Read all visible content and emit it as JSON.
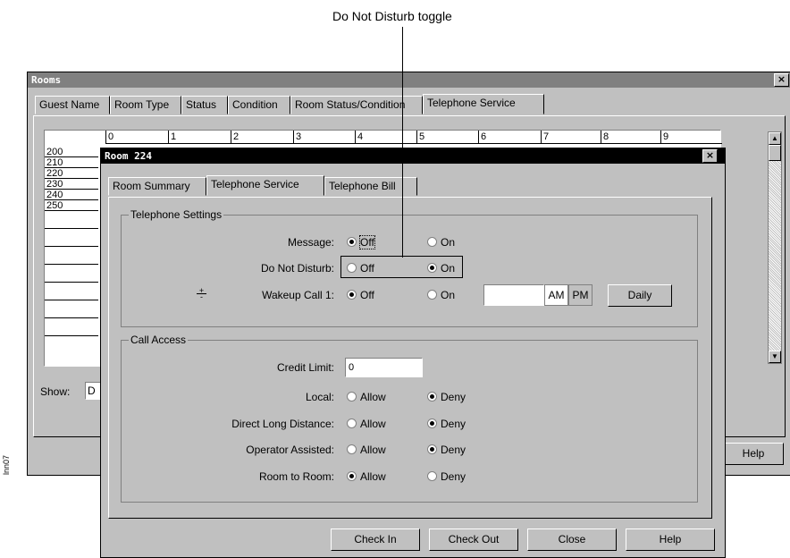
{
  "callout": {
    "label": "Do Not Disturb toggle"
  },
  "side_label": "lnn07",
  "rooms_window": {
    "title": "Rooms",
    "tabs": [
      "Guest Name",
      "Room Type",
      "Status",
      "Condition",
      "Room Status/Condition",
      "Telephone Service"
    ],
    "ruler": [
      "0",
      "1",
      "2",
      "3",
      "4",
      "5",
      "6",
      "7",
      "8",
      "9"
    ],
    "rows": [
      "200",
      "210",
      "220",
      "230",
      "240",
      "250",
      "",
      "",
      "",
      "",
      "",
      "",
      ""
    ],
    "show_label": "Show:",
    "show_value": "D",
    "help_button": "Help"
  },
  "room_dialog": {
    "title": "Room 224",
    "tabs": [
      "Room Summary",
      "Telephone Service",
      "Telephone Bill"
    ],
    "telephone_settings": {
      "legend": "Telephone Settings",
      "message": {
        "label": "Message:",
        "off": "Off",
        "on": "On",
        "selected": "Off"
      },
      "do_not_disturb": {
        "label": "Do Not Disturb:",
        "off": "Off",
        "on": "On",
        "selected": "On"
      },
      "wakeup": {
        "label": "Wakeup Call 1:",
        "off": "Off",
        "on": "On",
        "selected": "Off",
        "time_value": "",
        "am": "AM",
        "pm": "PM",
        "daily": "Daily"
      }
    },
    "call_access": {
      "legend": "Call Access",
      "credit_limit": {
        "label": "Credit Limit:",
        "value": "0"
      },
      "rows": [
        {
          "label": "Local:",
          "allow": "Allow",
          "deny": "Deny",
          "selected": "Deny"
        },
        {
          "label": "Direct Long Distance:",
          "allow": "Allow",
          "deny": "Deny",
          "selected": "Deny"
        },
        {
          "label": "Operator Assisted:",
          "allow": "Allow",
          "deny": "Deny",
          "selected": "Deny"
        },
        {
          "label": "Room to Room:",
          "allow": "Allow",
          "deny": "Deny",
          "selected": "Allow"
        }
      ]
    },
    "buttons": {
      "check_in": "Check In",
      "check_out": "Check Out",
      "close": "Close",
      "help": "Help"
    }
  }
}
